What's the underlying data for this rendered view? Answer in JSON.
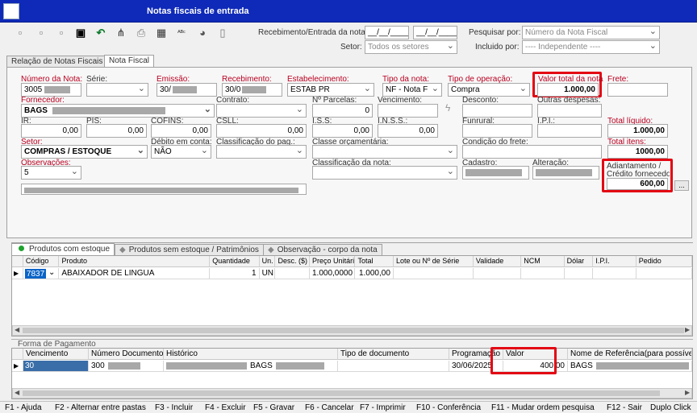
{
  "window": {
    "title": "Notas fiscais de entrada"
  },
  "filters": {
    "receb_label": "Recebimento/Entrada da nota:",
    "date_from": "__/__/____",
    "date_to": "__/__/____",
    "pesquisar_label": "Pesquisar por:",
    "pesquisar_value": "Número da Nota Fiscal",
    "setor_label": "Setor:",
    "setor_value": "Todos os setores",
    "incluido_label": "Incluido por:",
    "incluido_value": "---- Independente ----"
  },
  "tabs": {
    "relacao": "Relação de Notas Fiscais",
    "nota": "Nota Fiscal"
  },
  "form": {
    "numero_label": "Número da Nota:",
    "numero_value": "3005",
    "serie_label": "Série:",
    "serie_value": "",
    "emissao_label": "Emissão:",
    "emissao_value": "30/",
    "recebimento_label": "Recebimento:",
    "recebimento_value": "30/0",
    "estab_label": "Estabelecimento:",
    "estab_value": "ESTAB PR",
    "tipo_nota_label": "Tipo da nota:",
    "tipo_nota_value": "NF   - Nota F",
    "tipo_op_label": "Tipo de operação:",
    "tipo_op_value": "Compra",
    "valor_total_label": "Valor total da nota",
    "valor_total_value": "1.000,00",
    "frete_label": "Frete:",
    "frete_value": "",
    "fornecedor_label": "Fornecedor:",
    "fornecedor_value": "BAGS",
    "contrato_label": "Contrato:",
    "parcelas_label": "Nº Parcelas:",
    "parcelas_value": "0",
    "vencimento_label": "Vencimento:",
    "desconto_label": "Desconto:",
    "outras_label": "Outras despesas:",
    "ir_label": "IR:",
    "ir_value": "0,00",
    "pis_label": "PIS:",
    "pis_value": "0,00",
    "cofins_label": "COFINS:",
    "cofins_value": "0,00",
    "csll_label": "CSLL:",
    "csll_value": "0,00",
    "iss_label": "I.S.S:",
    "iss_value": "0,00",
    "inss_label": "I.N.S.S.:",
    "inss_value": "0,00",
    "funrural_label": "Funrural:",
    "ipi_label": "I.P.I.:",
    "total_liquido_label": "Total líquido:",
    "total_liquido_value": "1.000,00",
    "setor_label": "Setor:",
    "setor_value": "COMPRAS / ESTOQUE",
    "debito_label": "Débito em conta:",
    "debito_value": "NÃO",
    "class_pag_label": "Classificação do pag.:",
    "classe_orc_label": "Classe orçamentária:",
    "cond_frete_label": "Condição do frete:",
    "total_itens_label": "Total itens:",
    "total_itens_value": "1000,00",
    "obs_label": "Observações:",
    "obs_value": "5",
    "class_nota_label": "Classificação da nota:",
    "cadastro_label": "Cadastro:",
    "alteracao_label": "Alteração:",
    "adiant_label1": "Adiantamento /",
    "adiant_label2": "Crédito fornecedor",
    "adiant_value": "600,00",
    "dots": "..."
  },
  "subtabs": {
    "com_estoque": "Produtos com estoque",
    "sem_estoque": "Produtos sem estoque / Patrimônios",
    "obs": "Observação - corpo da nota"
  },
  "products": {
    "headers": [
      "Código",
      "Produto",
      "Quantidade",
      "Un.",
      "Desc. ($)",
      "Preço Unitário",
      "Total",
      "Lote ou Nº de Série",
      "Validade",
      "NCM",
      "Dólar",
      "I.P.I.",
      "Pedido"
    ],
    "row": {
      "codigo": "7837",
      "produto": "ABAIXADOR DE LINGUA",
      "quantidade": "1",
      "un": "UN",
      "desc": "",
      "preco": "1.000,0000",
      "total": "1.000,00"
    }
  },
  "payment": {
    "title": "Forma de Pagamento",
    "headers": [
      "Vencimento",
      "Número Documento",
      "Histórico",
      "Tipo de documento",
      "Programação",
      "Valor",
      "Nome de Referência(para possível em"
    ],
    "row": {
      "vencimento": "30",
      "documento": "300",
      "historico": "BAGS",
      "tipo": "",
      "programacao": "30/06/2025",
      "valor": "400,00",
      "nome": "BAGS"
    }
  },
  "status": [
    "F1 - Ajuda",
    "F2 - Alternar entre pastas",
    "F3 - Incluir",
    "F4 - Excluir",
    "F5 - Gravar",
    "F6 - Cancelar",
    "F7 - Imprimir",
    "F10 - Conferência",
    "F11 - Mudar ordem pesquisa",
    "F12 - Sair",
    "Duplo Click"
  ],
  "colors": {
    "title": "#0f2ab8",
    "highlight": "#e30613",
    "label_red": "#b80020",
    "selection": "#0a64c8"
  },
  "icons": [
    "new-icon",
    "copy-icon",
    "paste-icon",
    "save-icon",
    "undo-icon",
    "tree-icon",
    "print-icon",
    "calculator-icon",
    "spellcheck-icon",
    "money-bag-icon",
    "book-icon"
  ]
}
